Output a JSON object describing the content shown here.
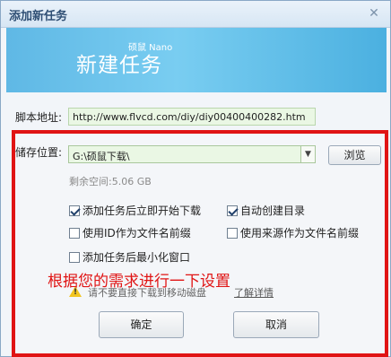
{
  "window": {
    "title": "添加新任务",
    "close_glyph": "✕"
  },
  "banner": {
    "title": "新建任务",
    "subtitle": "硕鼠 Nano"
  },
  "script": {
    "label": "脚本地址:",
    "url": "http://www.flvcd.com/diy/diy00400400282.htm"
  },
  "storage": {
    "label": "储存位置:",
    "path": "G:\\硕鼠下载\\",
    "browse_label": "浏览",
    "free_space": "剩余空间:5.06 GB"
  },
  "options": [
    {
      "label": "添加任务后立即开始下载",
      "checked": true
    },
    {
      "label": "自动创建目录",
      "checked": true
    },
    {
      "label": "使用ID作为文件名前缀",
      "checked": false
    },
    {
      "label": "使用来源作为文件名前缀",
      "checked": false
    },
    {
      "label": "添加任务后最小化窗口",
      "checked": false
    }
  ],
  "annotation": "根据您的需求进行一下设置",
  "warning": {
    "text": "请不要直接下载到移动磁盘",
    "link": "了解详情",
    "icon": "warning-icon"
  },
  "buttons": {
    "ok": "确定",
    "cancel": "取消"
  },
  "colors": {
    "annotation_red": "#e01414",
    "banner_blue": "#5fb8e5",
    "input_green": "#eaf7e4"
  }
}
